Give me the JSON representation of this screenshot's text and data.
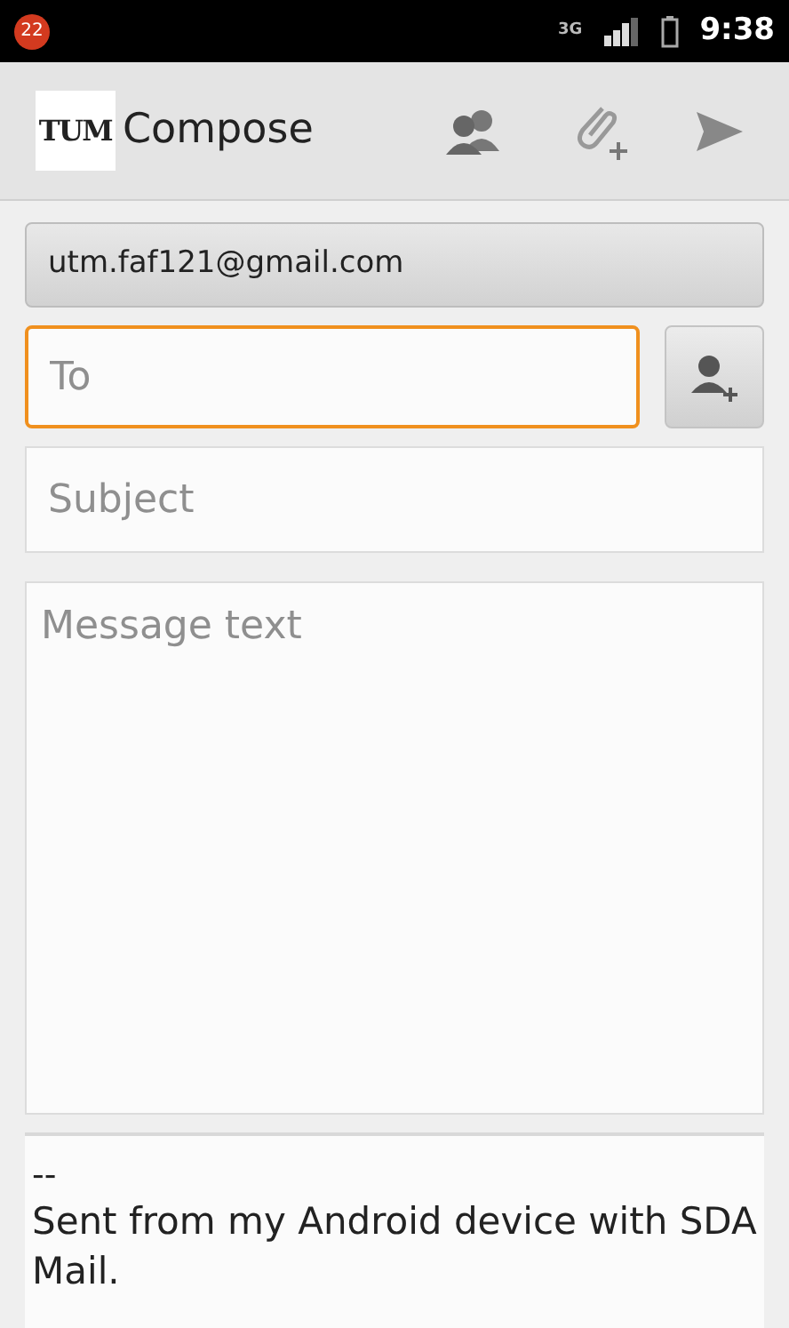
{
  "status_bar": {
    "notification_count": "22",
    "network": "3G",
    "time": "9:38"
  },
  "action_bar": {
    "logo_text": "TUM",
    "title": "Compose"
  },
  "account": {
    "label": "utm.faf121@gmail.com"
  },
  "to_field": {
    "placeholder": "To",
    "focused": true
  },
  "subject_field": {
    "placeholder": "Subject",
    "focused": false
  },
  "message_field": {
    "placeholder": "Message text"
  },
  "signature": {
    "separator": "--",
    "text": "Sent from my Android device with SDA Mail."
  }
}
